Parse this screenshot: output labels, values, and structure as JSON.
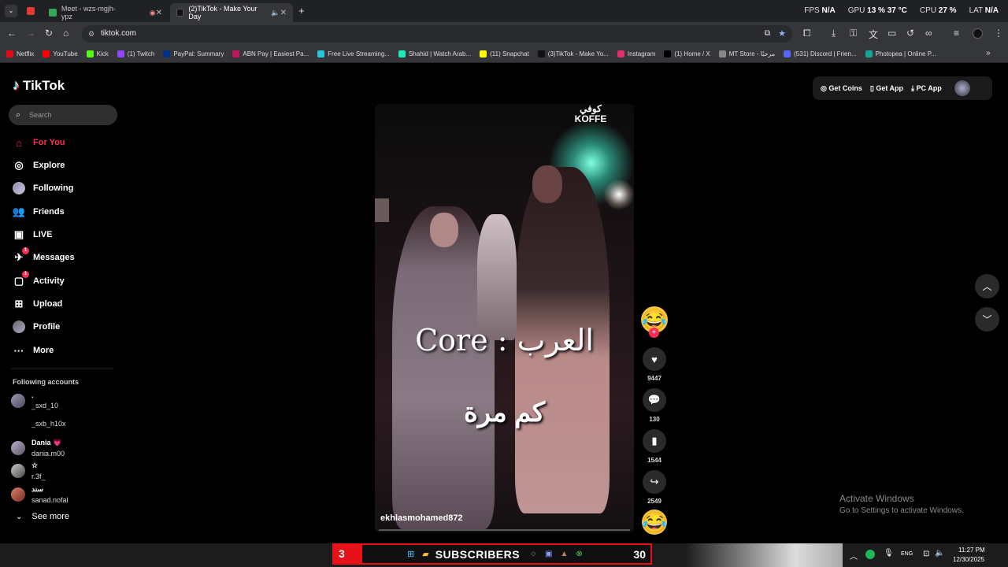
{
  "browser": {
    "tabs": [
      {
        "label": "Meet - wzs-mgjh-ypz",
        "fav_color": "#34a853"
      },
      {
        "label": "(2)TikTok - Make Your Day",
        "fav_color": "#111111"
      }
    ],
    "url": "tiktok.com",
    "hud": {
      "fps_label": "FPS",
      "fps": "N/A",
      "gpu_label": "GPU",
      "gpu": "13 %",
      "gpu_temp": "37 °C",
      "cpu_label": "CPU",
      "cpu": "27 %",
      "lat_label": "LAT",
      "lat": "N/A"
    },
    "bookmarks": [
      {
        "label": "Netflix",
        "color": "#e50914"
      },
      {
        "label": "YouTube",
        "color": "#ff0000"
      },
      {
        "label": "Kick",
        "color": "#53fc18"
      },
      {
        "label": "(1) Twitch",
        "color": "#9146ff"
      },
      {
        "label": "PayPal: Summary",
        "color": "#003087"
      },
      {
        "label": "ABN Pay | Easiest Pa...",
        "color": "#c2185b"
      },
      {
        "label": "Free Live Streaming...",
        "color": "#26c6da"
      },
      {
        "label": "Shahid | Watch Arab...",
        "color": "#1de9b6"
      },
      {
        "label": "(11) Snapchat",
        "color": "#fffc00"
      },
      {
        "label": "(3)TikTok - Make Yo...",
        "color": "#111111"
      },
      {
        "label": "Instagram",
        "color": "#e1306c"
      },
      {
        "label": "(1) Home / X",
        "color": "#000000"
      },
      {
        "label": "MT Store - مرحبًا",
        "color": "#888888"
      },
      {
        "label": "(531) Discord | Frien...",
        "color": "#5865f2"
      },
      {
        "label": "Photopea | Online P...",
        "color": "#18a497"
      }
    ]
  },
  "sidebar": {
    "brand": "TikTok",
    "search_placeholder": "Search",
    "nav": [
      {
        "label": "For You",
        "icon": "home-icon",
        "active": true
      },
      {
        "label": "Explore",
        "icon": "compass-icon"
      },
      {
        "label": "Following",
        "icon": "avatar"
      },
      {
        "label": "Friends",
        "icon": "friends-icon"
      },
      {
        "label": "LIVE",
        "icon": "live-icon"
      },
      {
        "label": "Messages",
        "icon": "messages-icon",
        "badge": "1"
      },
      {
        "label": "Activity",
        "icon": "activity-icon",
        "badge": "1"
      },
      {
        "label": "Upload",
        "icon": "upload-icon"
      },
      {
        "label": "Profile",
        "icon": "avatar"
      },
      {
        "label": "More",
        "icon": "more-icon"
      }
    ],
    "following_title": "Following accounts",
    "accounts": [
      {
        "name": ".",
        "handle": "_sxd_10"
      },
      {
        "name": "",
        "handle": "_sxb_h10x"
      },
      {
        "name": "Dania 💗",
        "handle": "dania.m00"
      },
      {
        "name": "☆",
        "handle": "r.3f_"
      },
      {
        "name": "سند",
        "handle": "sanad.nofal"
      }
    ],
    "see_more": "See more"
  },
  "video": {
    "brand_logo": "كوفي KOFFE",
    "caption_line1": "Core : العرب",
    "caption_line2": "كم مرة",
    "author": "ekhlasmohamed872"
  },
  "actions": {
    "likes": "9447",
    "comments": "130",
    "saves": "1544",
    "shares": "2549"
  },
  "topright": {
    "coins": "Get Coins",
    "app": "Get App",
    "pc": "PC App"
  },
  "watermark": {
    "line1": "Activate Windows",
    "line2": "Go to Settings to activate Windows."
  },
  "taskbar": {
    "subs_left": "3",
    "subs_label": "SUBSCRIBERS",
    "subs_right": "30",
    "lang": "ENG",
    "time": "11:27 PM",
    "date": "12/30/2025"
  },
  "colors": {
    "accent": "#fe2c55",
    "sub_red": "#e8111a"
  }
}
